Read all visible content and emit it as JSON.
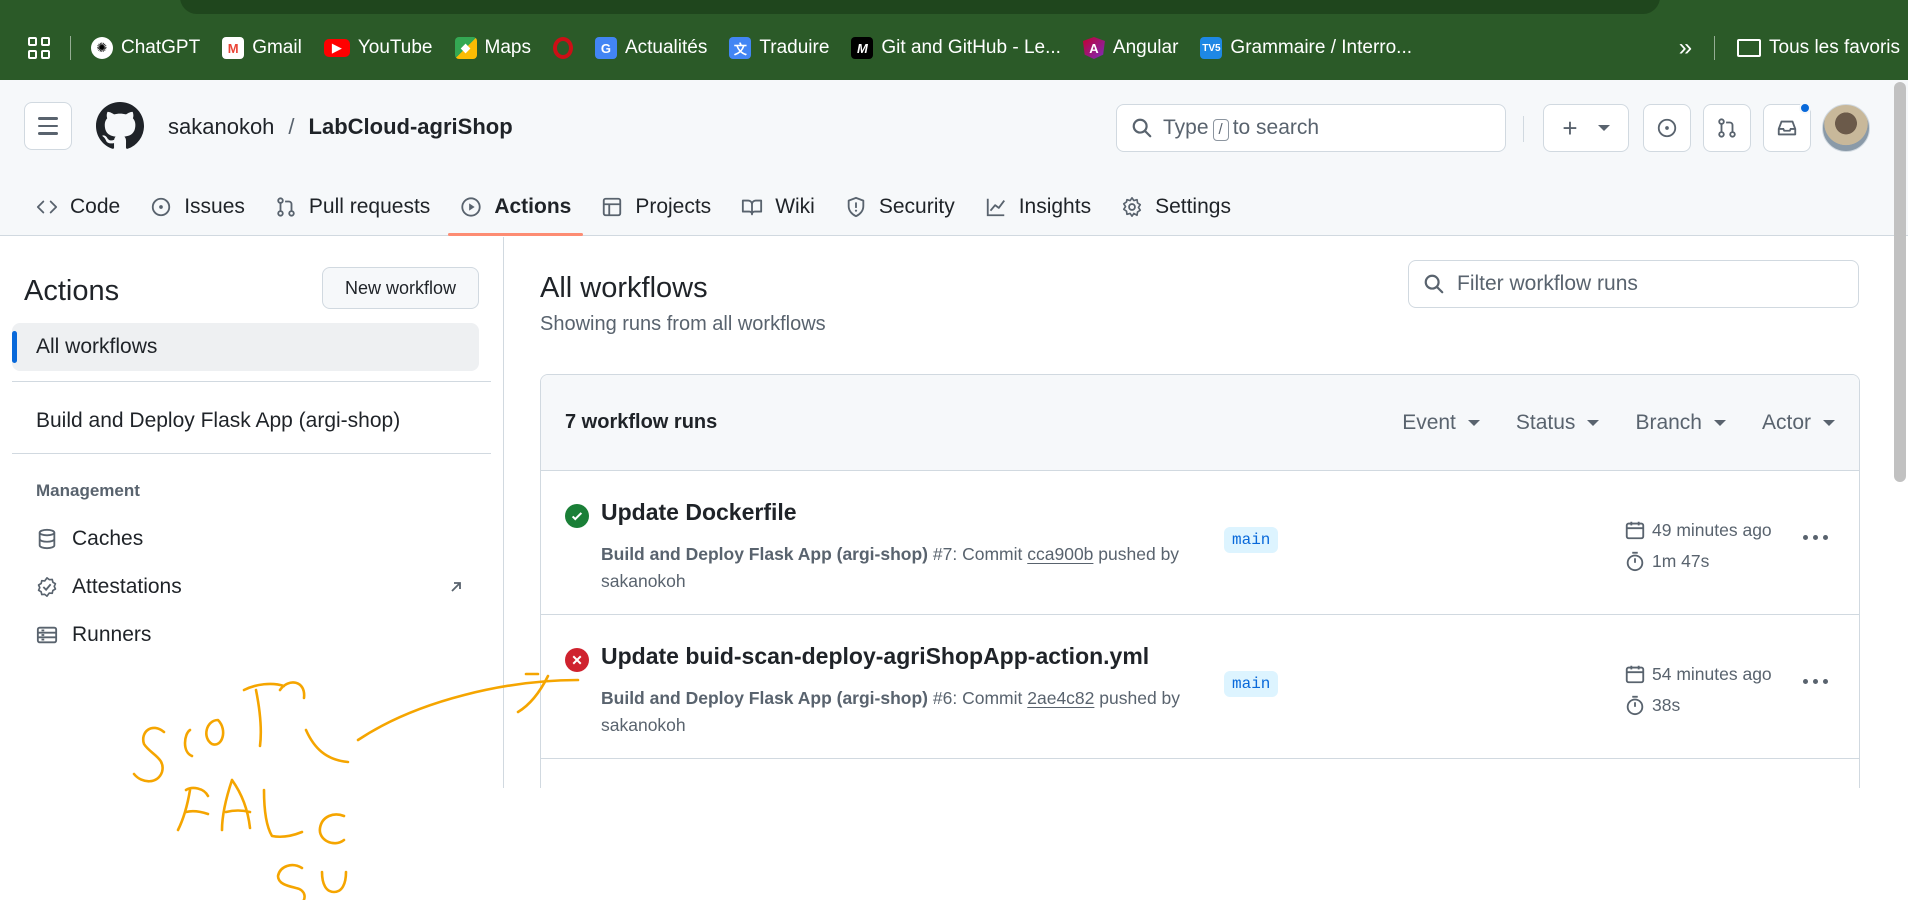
{
  "bookmarks": [
    {
      "label": "ChatGPT",
      "icon": "chatgpt-icon",
      "color": "#ffffff"
    },
    {
      "label": "Gmail",
      "icon": "gmail-icon",
      "color": "#ea4335"
    },
    {
      "label": "YouTube",
      "icon": "youtube-icon",
      "color": "#ff0000"
    },
    {
      "label": "Maps",
      "icon": "maps-icon",
      "color": "#34a853"
    },
    {
      "label": "",
      "icon": "opera-icon",
      "color": "#cc0f16"
    },
    {
      "label": "Actualités",
      "icon": "news-icon",
      "color": "#4285f4"
    },
    {
      "label": "Traduire",
      "icon": "translate-icon",
      "color": "#4285f4"
    },
    {
      "label": "Git and GitHub - Le...",
      "icon": "medium-icon",
      "color": "#000000"
    },
    {
      "label": "Angular",
      "icon": "angular-icon",
      "color": "#c3002f"
    },
    {
      "label": "Grammaire / Interro...",
      "icon": "tv5-icon",
      "color": "#1e88e5"
    }
  ],
  "bookmarks_overflow": "»",
  "all_bookmarks": "Tous les favoris",
  "repo": {
    "owner": "sakanokoh",
    "separator": "/",
    "name": "LabCloud-agriShop"
  },
  "search": {
    "prefix": "Type",
    "key": "/",
    "suffix": "to search"
  },
  "tabs": [
    {
      "label": "Code",
      "icon": "code-icon"
    },
    {
      "label": "Issues",
      "icon": "issue-icon"
    },
    {
      "label": "Pull requests",
      "icon": "pull-request-icon"
    },
    {
      "label": "Actions",
      "icon": "play-icon",
      "active": true
    },
    {
      "label": "Projects",
      "icon": "table-icon"
    },
    {
      "label": "Wiki",
      "icon": "book-icon"
    },
    {
      "label": "Security",
      "icon": "shield-icon"
    },
    {
      "label": "Insights",
      "icon": "graph-icon"
    },
    {
      "label": "Settings",
      "icon": "gear-icon"
    }
  ],
  "sidebar": {
    "title": "Actions",
    "new_workflow": "New workflow",
    "all_workflows": "All workflows",
    "workflows": [
      "Build and Deploy Flask App (argi-shop)"
    ],
    "management_heading": "Management",
    "management": [
      {
        "label": "Caches",
        "icon": "database-icon"
      },
      {
        "label": "Attestations",
        "icon": "verified-icon"
      },
      {
        "label": "Runners",
        "icon": "server-icon"
      }
    ]
  },
  "main": {
    "title": "All workflows",
    "subtitle": "Showing runs from all workflows",
    "filter_placeholder": "Filter workflow runs",
    "runs_count": "7 workflow runs",
    "filters": [
      "Event",
      "Status",
      "Branch",
      "Actor"
    ],
    "runs": [
      {
        "status": "success",
        "title": "Update Dockerfile",
        "workflow": "Build and Deploy Flask App (argi-shop)",
        "number": "#7",
        "commit_label": "Commit",
        "commit": "cca900b",
        "pushed_by": "pushed by",
        "author": "sakanokoh",
        "branch": "main",
        "when": "49 minutes ago",
        "duration": "1m 47s"
      },
      {
        "status": "failure",
        "title": "Update buid-scan-deploy-agriShopApp-action.yml",
        "workflow": "Build and Deploy Flask App (argi-shop)",
        "number": "#6",
        "commit_label": "Commit",
        "commit": "2ae4c82",
        "pushed_by": "pushed by",
        "author": "sakanokoh",
        "branch": "main",
        "when": "54 minutes ago",
        "duration": "38s"
      }
    ]
  },
  "colors": {
    "success": "#1a7f37",
    "failure": "#cf222e",
    "accent": "#fd8c73",
    "annotation": "#f5a500"
  }
}
